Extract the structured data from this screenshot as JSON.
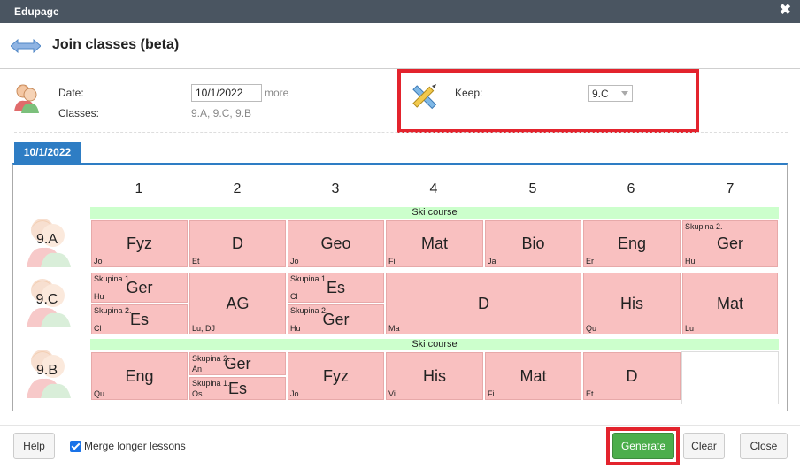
{
  "window": {
    "title": "Edupage",
    "close_glyph": "✖"
  },
  "dialog": {
    "title": "Join classes (beta)"
  },
  "form": {
    "date_label": "Date:",
    "date_value": "10/1/2022",
    "more_label": "more",
    "classes_label": "Classes:",
    "classes_value": "9.A, 9.C, 9.B",
    "keep_label": "Keep:",
    "keep_value": "9.C"
  },
  "timetable": {
    "tab_label": "10/1/2022",
    "periods": [
      "1",
      "2",
      "3",
      "4",
      "5",
      "6",
      "7"
    ],
    "rows": [
      {
        "class": "9.A",
        "banner": "Ski course",
        "cells": [
          {
            "subject": "Fyz",
            "teacher": "Jo"
          },
          {
            "subject": "D",
            "teacher": "Et"
          },
          {
            "subject": "Geo",
            "teacher": "Jo"
          },
          {
            "subject": "Mat",
            "teacher": "Fi"
          },
          {
            "subject": "Bio",
            "teacher": "Ja"
          },
          {
            "subject": "Eng",
            "teacher": "Er"
          },
          {
            "subject": "Ger",
            "teacher": "Hu",
            "group": "Skupina 2."
          }
        ]
      },
      {
        "class": "9.C",
        "cells": [
          {
            "subject": "Ger",
            "teacher": "Hu",
            "group": "Skupina 1."
          },
          {
            "subject": "Es",
            "teacher": "Cl",
            "group": "Skupina 2."
          },
          {
            "subject": "AG",
            "teacher": "Lu, DJ"
          },
          {
            "subject": "Es",
            "teacher": "Cl",
            "group": "Skupina 1."
          },
          {
            "subject": "Ger",
            "teacher": "Hu",
            "group": "Skupina 2."
          },
          {
            "subject": "D",
            "teacher": "Ma"
          },
          {
            "subject": "His",
            "teacher": "Qu"
          },
          {
            "subject": "Mat",
            "teacher": "Lu"
          }
        ]
      },
      {
        "class": "9.B",
        "banner": "Ski course",
        "cells": [
          {
            "subject": "Eng",
            "teacher": "Qu"
          },
          {
            "subject": "Ger",
            "teacher": "An",
            "group": "Skupina 2."
          },
          {
            "subject": "Es",
            "teacher": "Os",
            "group": "Skupina 1."
          },
          {
            "subject": "Fyz",
            "teacher": "Jo"
          },
          {
            "subject": "His",
            "teacher": "Vi"
          },
          {
            "subject": "Mat",
            "teacher": "Fi"
          },
          {
            "subject": "D",
            "teacher": "Et"
          }
        ]
      }
    ]
  },
  "footer": {
    "help_label": "Help",
    "merge_label": "Merge longer lessons",
    "generate_label": "Generate",
    "clear_label": "Clear",
    "close_label": "Close"
  },
  "colors": {
    "titlebar": "#4a5561",
    "accent": "#2e7dc4",
    "lesson": "#f9c0c0",
    "banner": "#ccffcc",
    "highlight": "#e3232d",
    "generate": "#4cae4c"
  }
}
